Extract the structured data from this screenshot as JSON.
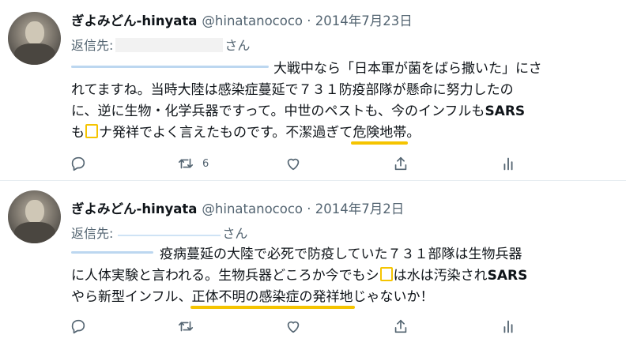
{
  "tweets": [
    {
      "name": "ぎよみどん-hinyata",
      "handle": "@hinatanococo · 2014年7月23日",
      "reply_prefix": "返信先:",
      "reply_suffix": "さん",
      "lines": [
        [
          "大戦中なら「日本軍が菌をばら撒いた」にさ"
        ],
        [
          "れてますね。当時大陸は感染症蔓延で７３１防疫部隊が懸命に努力したの"
        ],
        [
          "に、逆に生物・化学兵器ですって。中世のペストも、今のインフルも",
          "SARS"
        ],
        [
          "も",
          "ナ発祥でよく言えたものです。不潔過ぎて",
          "危険地帯",
          "。"
        ]
      ],
      "retweet_count": "6"
    },
    {
      "name": "ぎよみどん-hinyata",
      "handle": "@hinatanococo · 2014年7月2日",
      "reply_prefix": "返信先:",
      "reply_suffix": "さん",
      "lines": [
        [
          "疫病蔓延の大陸で必死で防疫していた７３１部隊は生物兵器"
        ],
        [
          "に人体実験と言われる。生物兵器どころか今でもシ",
          "は水は汚染され",
          "SARS"
        ],
        [
          "やら新型インフル、",
          "正体不明の感染症の発祥地",
          "じゃないか！"
        ]
      ]
    }
  ],
  "icons": [
    "reply-icon",
    "retweet-icon",
    "like-icon",
    "share-icon",
    "analytics-icon"
  ],
  "colors": {
    "highlight": "#f5c400",
    "secondary_text": "#536471",
    "divider": "#e6ecf0"
  }
}
